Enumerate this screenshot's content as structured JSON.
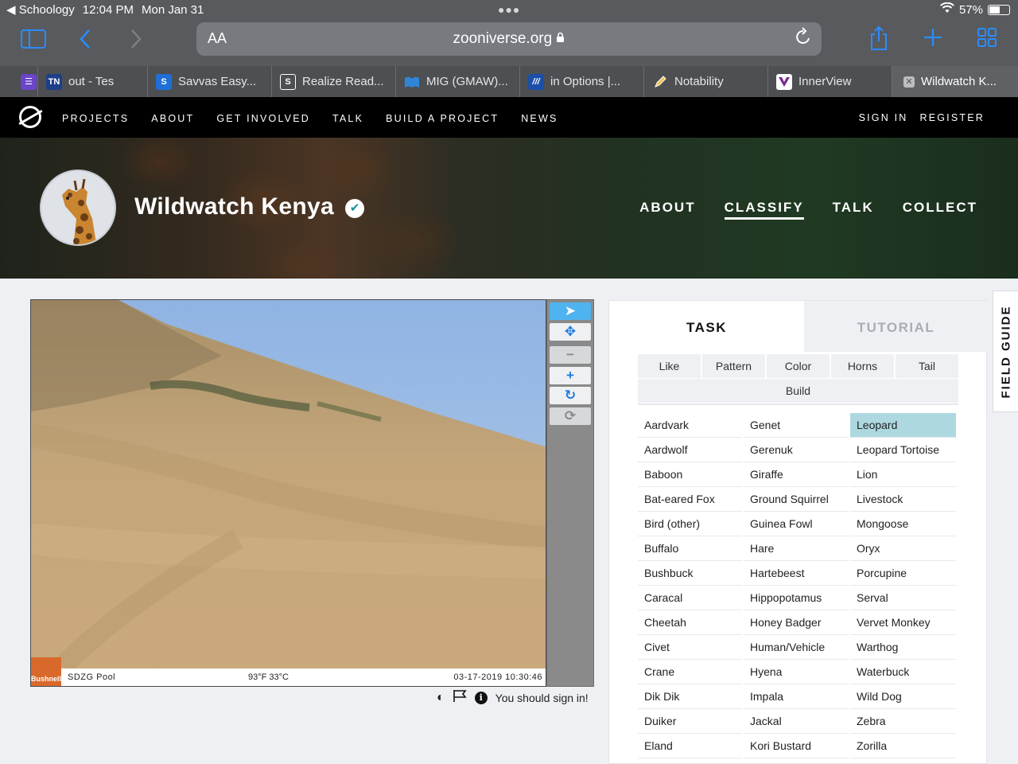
{
  "status_bar": {
    "back_app": "Schoology",
    "time": "12:04 PM",
    "date": "Mon Jan 31",
    "battery": "57%",
    "battery_level": 0.57
  },
  "safari": {
    "text_size_label": "AA",
    "url_host": "zooniverse.org",
    "tabs": [
      {
        "label": "",
        "icon": "notes-icon"
      },
      {
        "label": "out - Tes",
        "icon": "TN"
      },
      {
        "label": "Savvas Easy...",
        "icon": "S"
      },
      {
        "label": "Realize Read...",
        "icon": "S"
      },
      {
        "label": "MIG (GMAW)...",
        "icon": "book-icon"
      },
      {
        "label": "in Options |...",
        "icon": "stripes-icon"
      },
      {
        "label": "Notability",
        "icon": "pencil-icon"
      },
      {
        "label": "InnerView",
        "icon": "v-icon"
      },
      {
        "label": "Wildwatch K...",
        "icon": "close-icon"
      }
    ]
  },
  "zooniverse_nav": {
    "links": [
      "PROJECTS",
      "ABOUT",
      "GET INVOLVED",
      "TALK",
      "BUILD A PROJECT",
      "NEWS"
    ],
    "sign_in": "SIGN IN",
    "register": "REGISTER"
  },
  "project": {
    "title": "Wildwatch Kenya",
    "nav": [
      "ABOUT",
      "CLASSIFY",
      "TALK",
      "COLLECT"
    ],
    "active_nav": "CLASSIFY"
  },
  "subject": {
    "brand": "Bushnell",
    "camera": "SDZG Pool",
    "temperature": "93°F 33°C",
    "timestamp": "03-17-2019 10:30:46",
    "sign_in_note": "You should sign in!"
  },
  "task_panel": {
    "tab_task": "TASK",
    "tab_tutorial": "TUTORIAL",
    "filters": [
      "Like",
      "Pattern",
      "Color",
      "Horns",
      "Tail",
      "Build"
    ],
    "selected": "Leopard",
    "choices": [
      [
        "Aardvark",
        "Genet",
        "Leopard"
      ],
      [
        "Aardwolf",
        "Gerenuk",
        "Leopard Tortoise"
      ],
      [
        "Baboon",
        "Giraffe",
        "Lion"
      ],
      [
        "Bat-eared Fox",
        "Ground Squirrel",
        "Livestock"
      ],
      [
        "Bird (other)",
        "Guinea Fowl",
        "Mongoose"
      ],
      [
        "Buffalo",
        "Hare",
        "Oryx"
      ],
      [
        "Bushbuck",
        "Hartebeest",
        "Porcupine"
      ],
      [
        "Caracal",
        "Hippopotamus",
        "Serval"
      ],
      [
        "Cheetah",
        "Honey Badger",
        "Vervet Monkey"
      ],
      [
        "Civet",
        "Human/Vehicle",
        "Warthog"
      ],
      [
        "Crane",
        "Hyena",
        "Waterbuck"
      ],
      [
        "Dik Dik",
        "Impala",
        "Wild Dog"
      ],
      [
        "Duiker",
        "Jackal",
        "Zebra"
      ],
      [
        "Eland",
        "Kori Bustard",
        "Zorilla"
      ]
    ]
  },
  "field_guide": "FIELD GUIDE",
  "colors": {
    "safari_blue": "#2a8cff",
    "selected_choice": "#add8e0",
    "nav_bg": "#000000"
  }
}
